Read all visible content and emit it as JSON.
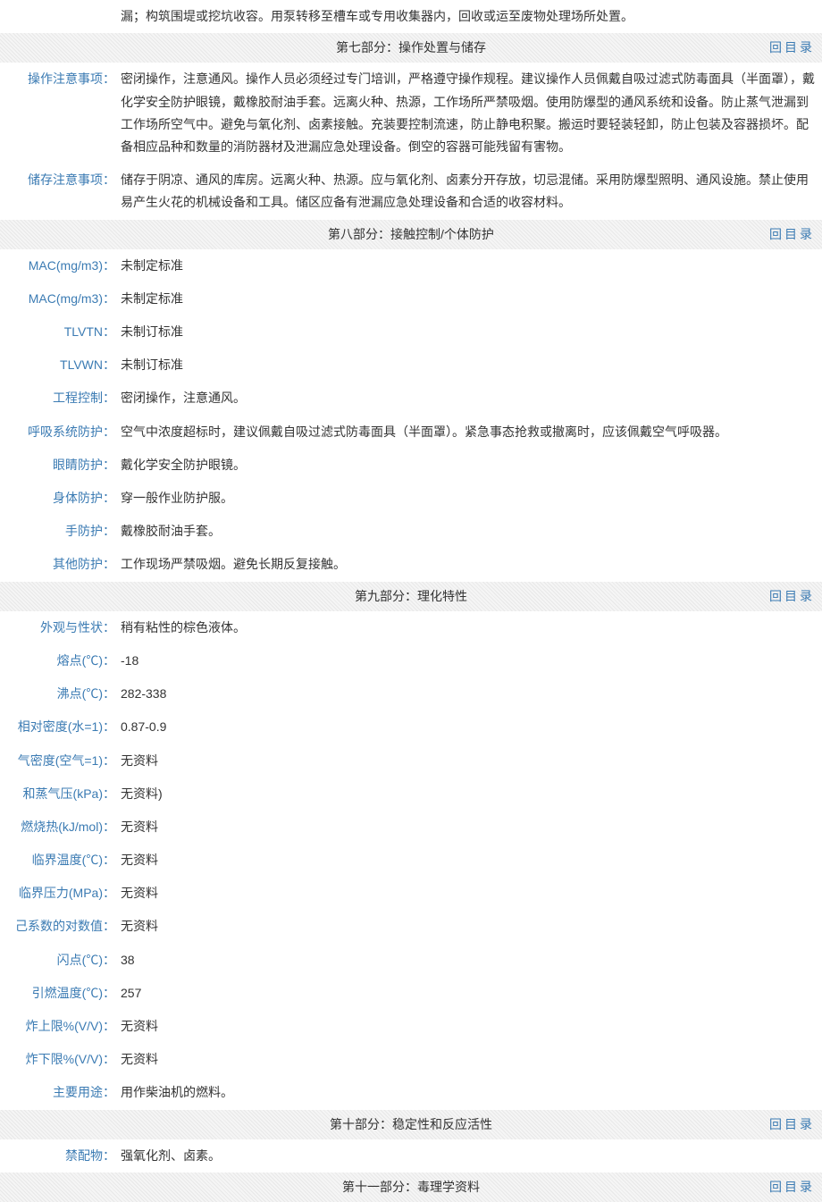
{
  "top_fragment": "漏；构筑围堤或挖坑收容。用泵转移至槽车或专用收集器内，回收或运至废物处理场所处置。",
  "back_link": "回目录",
  "section7": {
    "title": "第七部分：操作处置与储存",
    "rows": [
      {
        "label": "操作注意事项：",
        "value": "密闭操作，注意通风。操作人员必须经过专门培训，严格遵守操作规程。建议操作人员佩戴自吸过滤式防毒面具（半面罩），戴化学安全防护眼镜，戴橡胶耐油手套。远离火种、热源，工作场所严禁吸烟。使用防爆型的通风系统和设备。防止蒸气泄漏到工作场所空气中。避免与氧化剂、卤素接触。充装要控制流速，防止静电积聚。搬运时要轻装轻卸，防止包装及容器损坏。配备相应品种和数量的消防器材及泄漏应急处理设备。倒空的容器可能残留有害物。"
      },
      {
        "label": "储存注意事项：",
        "value": "储存于阴凉、通风的库房。远离火种、热源。应与氧化剂、卤素分开存放，切忌混储。采用防爆型照明、通风设施。禁止使用易产生火花的机械设备和工具。储区应备有泄漏应急处理设备和合适的收容材料。"
      }
    ]
  },
  "section8": {
    "title": "第八部分：接触控制/个体防护",
    "rows": [
      {
        "label": "MAC(mg/m3)：",
        "value": "未制定标准"
      },
      {
        "label": "MAC(mg/m3)：",
        "value": "未制定标准"
      },
      {
        "label": "TLVTN：",
        "value": "未制订标准"
      },
      {
        "label": "TLVWN：",
        "value": "未制订标准"
      },
      {
        "label": "工程控制：",
        "value": "密闭操作，注意通风。"
      },
      {
        "label": "呼吸系统防护：",
        "value": "空气中浓度超标时，建议佩戴自吸过滤式防毒面具（半面罩）。紧急事态抢救或撤离时，应该佩戴空气呼吸器。"
      },
      {
        "label": "眼睛防护：",
        "value": "戴化学安全防护眼镜。"
      },
      {
        "label": "身体防护：",
        "value": "穿一般作业防护服。"
      },
      {
        "label": "手防护：",
        "value": "戴橡胶耐油手套。"
      },
      {
        "label": "其他防护：",
        "value": "工作现场严禁吸烟。避免长期反复接触。"
      }
    ]
  },
  "section9": {
    "title": "第九部分：理化特性",
    "rows": [
      {
        "label": "外观与性状：",
        "value": "稍有粘性的棕色液体。"
      },
      {
        "label": "熔点(℃)：",
        "value": "-18"
      },
      {
        "label": "沸点(℃)：",
        "value": "282-338"
      },
      {
        "label": "相对密度(水=1)：",
        "value": "0.87-0.9"
      },
      {
        "label": "气密度(空气=1)：",
        "value": "无资料"
      },
      {
        "label": "和蒸气压(kPa)：",
        "value": "无资料)"
      },
      {
        "label": "燃烧热(kJ/mol)：",
        "value": "无资料"
      },
      {
        "label": "临界温度(℃)：",
        "value": "无资料"
      },
      {
        "label": "临界压力(MPa)：",
        "value": "无资料"
      },
      {
        "label": "己系数的对数值：",
        "value": "无资料"
      },
      {
        "label": "闪点(℃)：",
        "value": "38"
      },
      {
        "label": "引燃温度(℃)：",
        "value": "257"
      },
      {
        "label": "炸上限%(V/V)：",
        "value": "无资料"
      },
      {
        "label": "炸下限%(V/V)：",
        "value": "无资料"
      },
      {
        "label": "主要用途：",
        "value": "用作柴油机的燃料。"
      }
    ]
  },
  "section10": {
    "title": "第十部分：稳定性和反应活性",
    "rows": [
      {
        "label": "禁配物：",
        "value": "强氧化剂、卤素。"
      }
    ]
  },
  "section11": {
    "title": "第十一部分：毒理学资料"
  }
}
